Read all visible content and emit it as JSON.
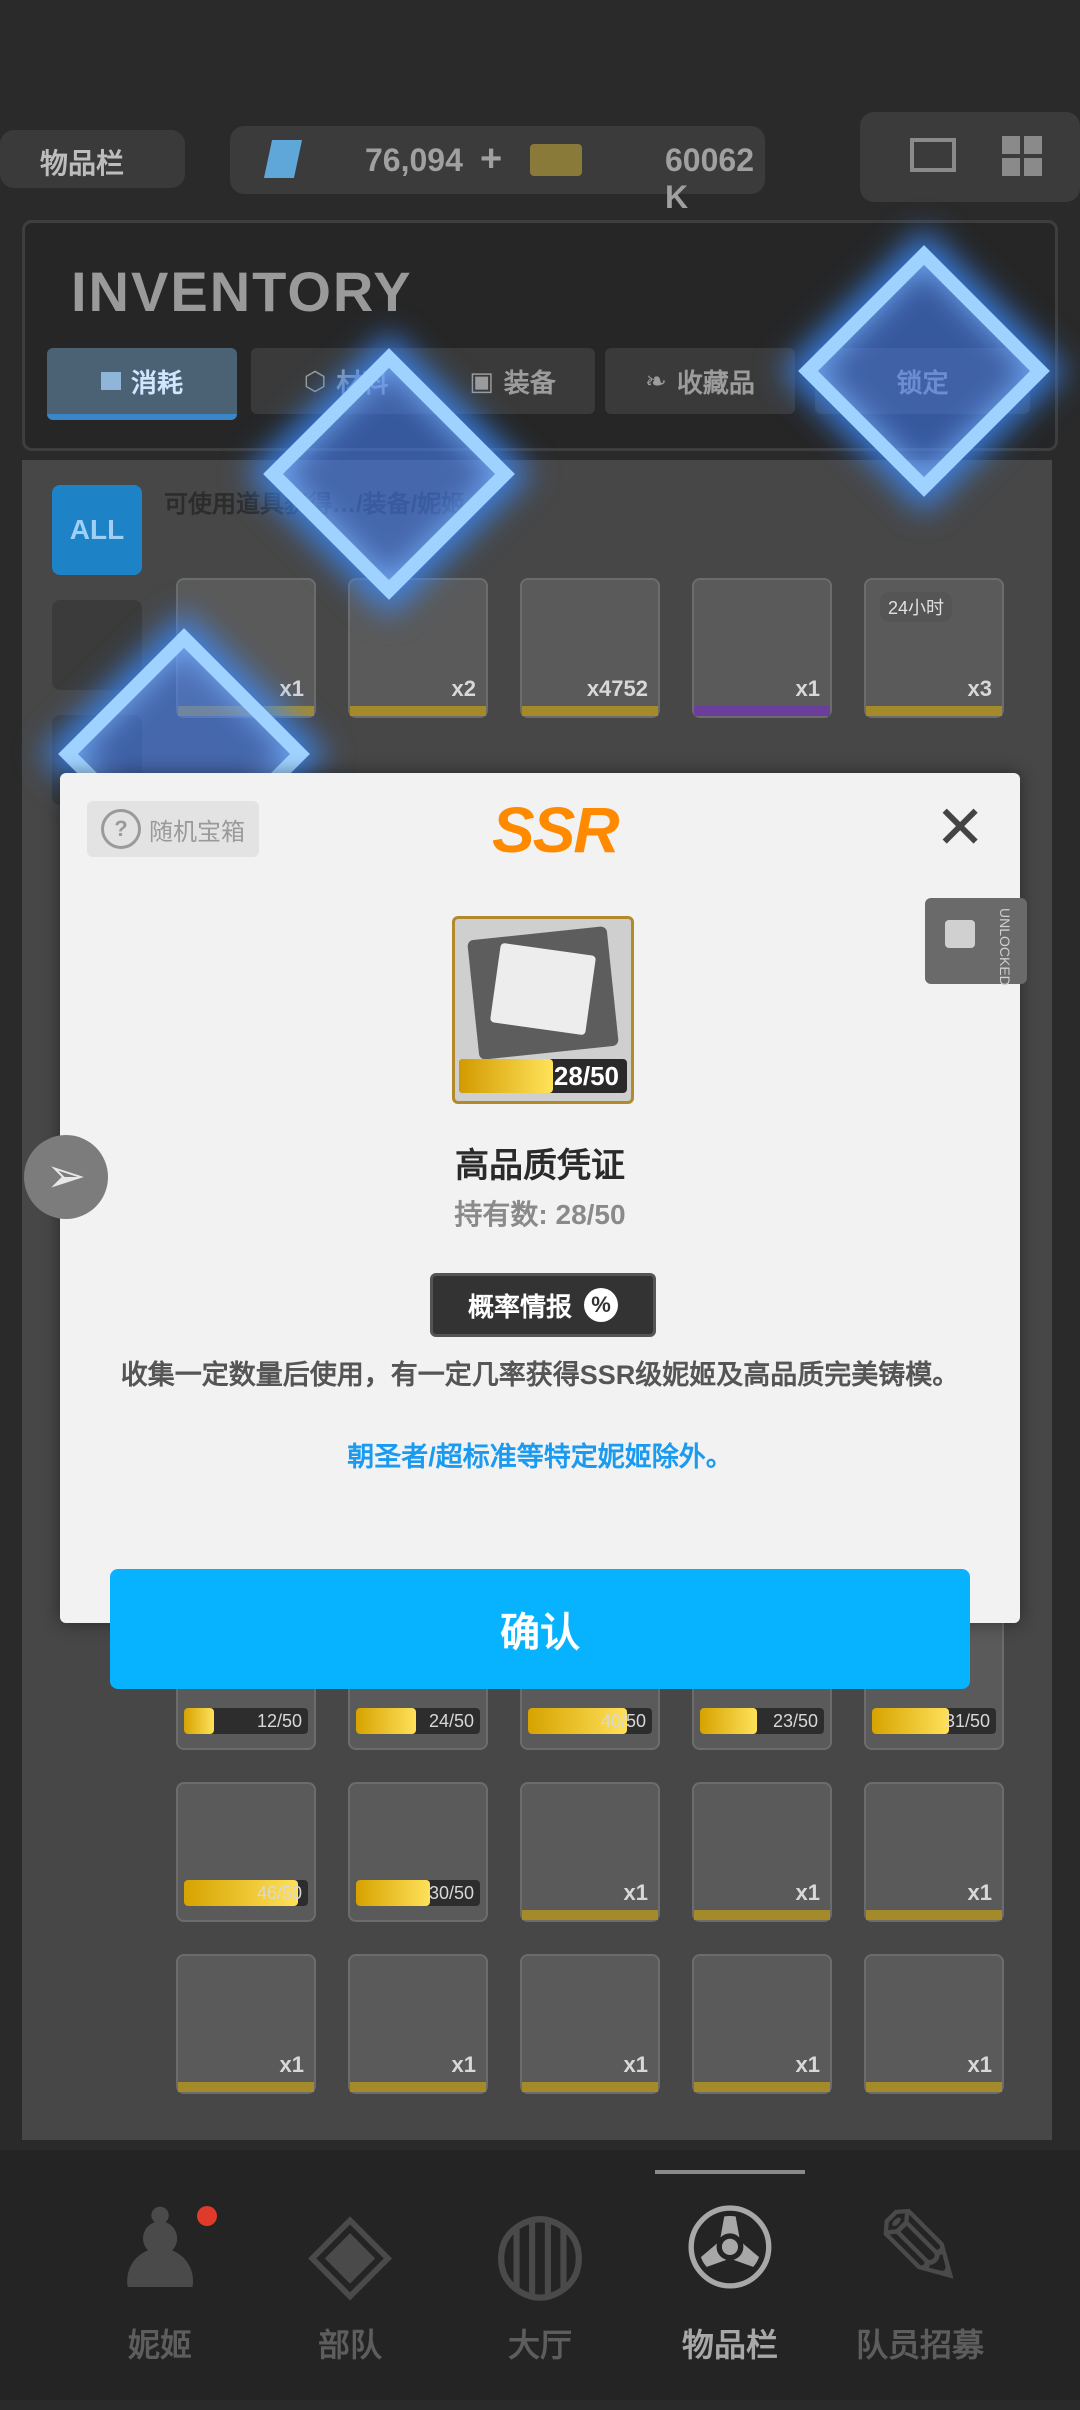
{
  "topbar": {
    "title": "物品栏",
    "currency1": "76,094",
    "plus": "+",
    "currency2": "60062 K"
  },
  "inventory": {
    "title": "INVENTORY",
    "tabs": [
      {
        "label": "消耗",
        "active": true
      },
      {
        "label": "材料",
        "active": false
      },
      {
        "label": "装备",
        "active": false
      },
      {
        "label": "收藏品",
        "active": false
      },
      {
        "label": "锁定",
        "active": false
      }
    ],
    "all_label": "ALL",
    "hint": "可使用道具获得…/装备/妮姬。"
  },
  "grid_rows": [
    [
      {
        "count": "x1",
        "rarity": "gold"
      },
      {
        "count": "x2",
        "rarity": "gold"
      },
      {
        "count": "x4752",
        "rarity": "gold"
      },
      {
        "count": "x1",
        "rarity": "purple"
      },
      {
        "count": "x3",
        "rarity": "gold",
        "tag": "24小时"
      }
    ],
    [
      {
        "progress": "12/50",
        "fill": 0.24
      },
      {
        "progress": "24/50",
        "fill": 0.48
      },
      {
        "progress": "40/50",
        "fill": 0.8
      },
      {
        "progress": "23/50",
        "fill": 0.46
      },
      {
        "progress": "31/50",
        "fill": 0.62
      }
    ],
    [
      {
        "progress": "46/50",
        "fill": 0.92
      },
      {
        "progress": "30/50",
        "fill": 0.6,
        "rarity": "purple"
      },
      {
        "count": "x1",
        "rarity": "gold"
      },
      {
        "count": "x1",
        "rarity": "gold"
      },
      {
        "count": "x1",
        "rarity": "gold"
      }
    ],
    [
      {
        "count": "x1",
        "rarity": "gold"
      },
      {
        "count": "x1",
        "rarity": "gold"
      },
      {
        "count": "x1",
        "rarity": "gold"
      },
      {
        "count": "x1",
        "rarity": "gold"
      },
      {
        "count": "x1",
        "rarity": "gold"
      }
    ]
  ],
  "dialog": {
    "badge": "随机宝箱",
    "rarity": "SSR",
    "close": "✕",
    "item_progress": "28/50",
    "item_fill": 0.56,
    "item_name": "高品质凭证",
    "owned": "持有数: 28/50",
    "prob_button": "概率情报",
    "prob_icon": "%",
    "description": "收集一定数量后使用，有一定几率获得SSR级妮姬及高品质完美铸模。",
    "note": "朝圣者/超标准等特定妮姬除外。",
    "confirm": "确认"
  },
  "side": {
    "lock_label": "UNLOCKED"
  },
  "nav": [
    {
      "label": "妮姬",
      "icon": "nikke-icon",
      "active": false
    },
    {
      "label": "部队",
      "icon": "squad-icon",
      "active": false
    },
    {
      "label": "大厅",
      "icon": "lobby-icon",
      "active": false
    },
    {
      "label": "物品栏",
      "icon": "inventory-icon",
      "active": true
    },
    {
      "label": "队员招募",
      "icon": "recruit-icon",
      "active": false
    }
  ],
  "colors": {
    "accent": "#07b3ff",
    "ssr": "#ff8a00",
    "note": "#1a9bf0"
  }
}
